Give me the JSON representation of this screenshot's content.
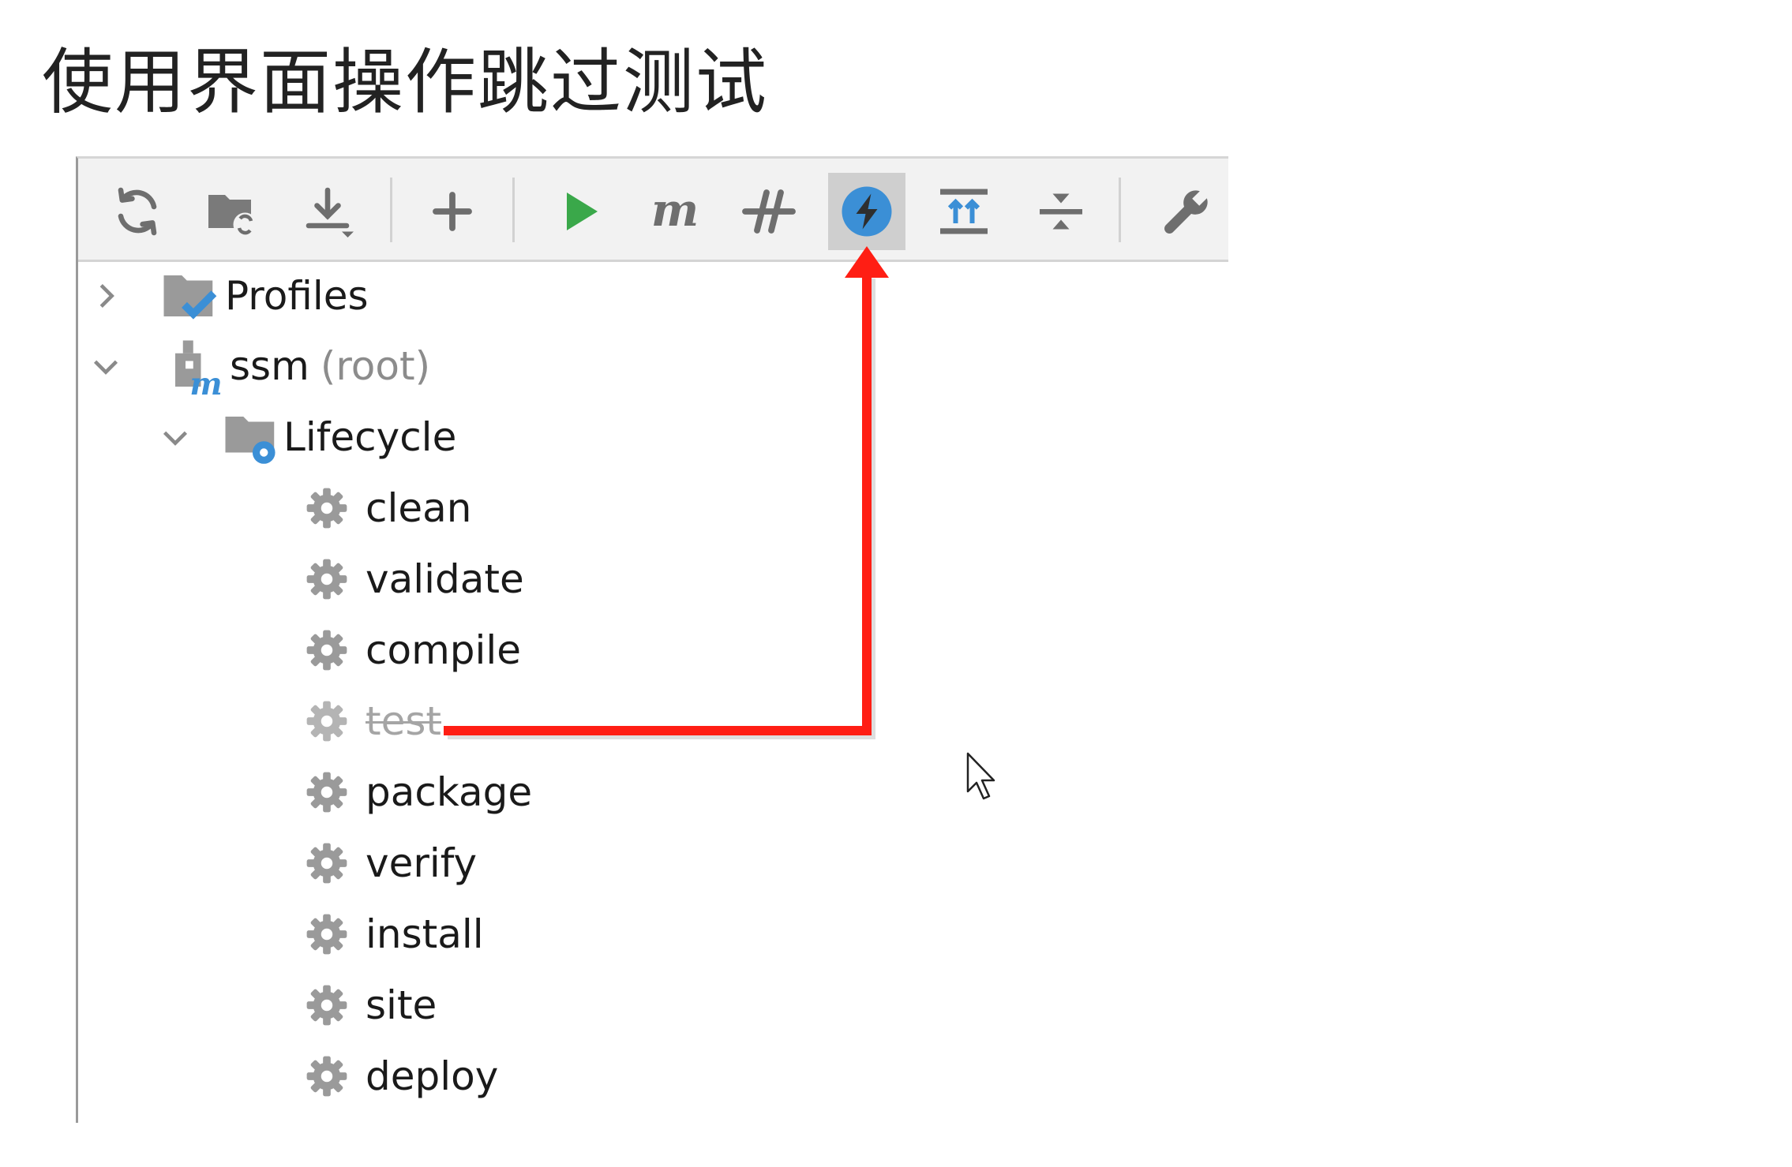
{
  "page": {
    "title": "使用界面操作跳过测试"
  },
  "colors": {
    "accent_blue": "#3b8fd6",
    "run_green": "#3aa84a",
    "annotation_red": "#ff1e14",
    "icon_gray": "#6e6e6e",
    "toolbar_bg": "#f2f2f2",
    "active_button_bg": "#cfcfcf"
  },
  "toolbar": {
    "buttons": [
      {
        "icon": "reload-icon"
      },
      {
        "icon": "generate-sources-icon"
      },
      {
        "icon": "download-icon"
      },
      {
        "icon": "add-icon"
      },
      {
        "icon": "run-icon"
      },
      {
        "icon": "maven-goal-icon",
        "label": "m"
      },
      {
        "icon": "toggle-offline-icon"
      },
      {
        "icon": "skip-tests-icon",
        "active": true
      },
      {
        "icon": "show-dependencies-icon"
      },
      {
        "icon": "collapse-all-icon"
      },
      {
        "icon": "settings-wrench-icon"
      }
    ]
  },
  "tree": {
    "profiles": {
      "label": "Profiles",
      "expanded": false
    },
    "project": {
      "name": "ssm",
      "suffix": "(root)",
      "expanded": true
    },
    "lifecycle": {
      "label": "Lifecycle",
      "expanded": true,
      "phases": [
        {
          "name": "clean",
          "skipped": false
        },
        {
          "name": "validate",
          "skipped": false
        },
        {
          "name": "compile",
          "skipped": false
        },
        {
          "name": "test",
          "skipped": true
        },
        {
          "name": "package",
          "skipped": false
        },
        {
          "name": "verify",
          "skipped": false
        },
        {
          "name": "install",
          "skipped": false
        },
        {
          "name": "site",
          "skipped": false
        },
        {
          "name": "deploy",
          "skipped": false
        }
      ]
    }
  }
}
